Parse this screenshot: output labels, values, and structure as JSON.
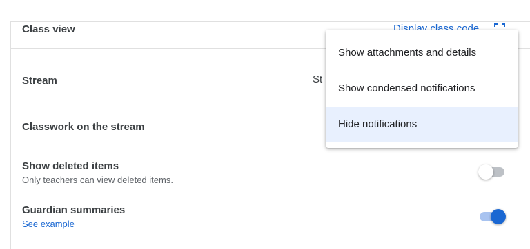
{
  "settings": {
    "class_view": {
      "label": "Class view",
      "display_code_label": "Display class code"
    },
    "stream": {
      "label": "Stream",
      "value_partial": "St"
    },
    "classwork_stream": {
      "label": "Classwork on the stream"
    },
    "show_deleted": {
      "label": "Show deleted items",
      "description": "Only teachers can view deleted items.",
      "enabled": false
    },
    "guardian": {
      "label": "Guardian summaries",
      "link": "See example",
      "enabled": true
    }
  },
  "menu": {
    "items": [
      {
        "label": "Show attachments and details",
        "selected": false
      },
      {
        "label": "Show condensed notifications",
        "selected": false
      },
      {
        "label": "Hide notifications",
        "selected": true
      }
    ]
  },
  "colors": {
    "accent": "#1a67d2",
    "menu_selected": "#e8f0fe",
    "divider": "#e0e0e0"
  }
}
